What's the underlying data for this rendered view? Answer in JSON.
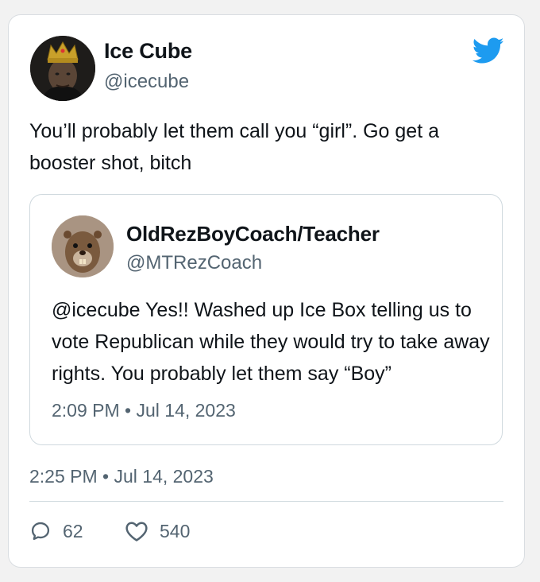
{
  "tweet": {
    "author": {
      "name": "Ice Cube",
      "handle": "@icecube"
    },
    "text": "You’ll probably let them call you “girl”. Go get a booster shot, bitch",
    "timestamp": "2:25 PM • Jul 14, 2023",
    "stats": {
      "replies": "62",
      "likes": "540"
    }
  },
  "quoted_tweet": {
    "author": {
      "name": "OldRezBoyCoach/Teacher",
      "handle": "@MTRezCoach"
    },
    "text": "@icecube Yes!! Washed up Ice Box telling us to vote Republican while they would try to take away rights. You probably let them say “Boy”",
    "timestamp": "2:09 PM • Jul 14, 2023"
  },
  "icons": {
    "brand": "twitter-bird-icon",
    "reply": "reply-bubble-icon",
    "like": "heart-icon"
  },
  "colors": {
    "twitter_blue": "#1d9bf0",
    "secondary_text": "#536471",
    "border": "#cfd9de"
  }
}
